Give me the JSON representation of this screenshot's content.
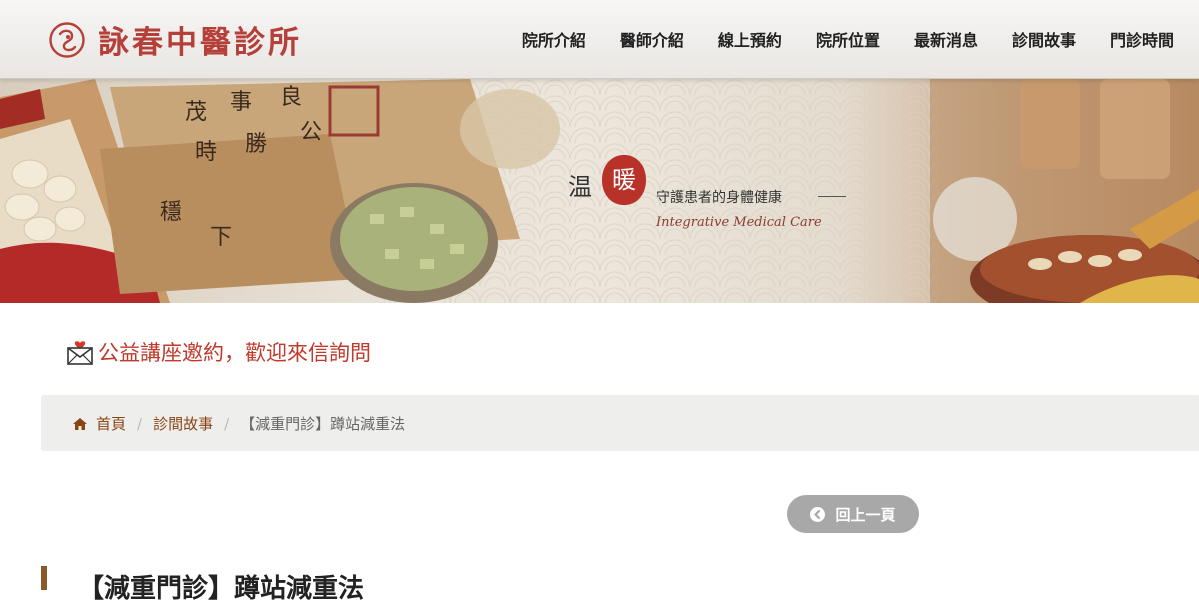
{
  "header": {
    "logo_text": "詠春中醫診所",
    "nav": [
      {
        "label": "院所介紹"
      },
      {
        "label": "醫師介紹"
      },
      {
        "label": "線上預約"
      },
      {
        "label": "院所位置"
      },
      {
        "label": "最新消息"
      },
      {
        "label": "診間故事"
      },
      {
        "label": "門診時間"
      }
    ]
  },
  "banner": {
    "calligraphy": "温",
    "seal": "暖",
    "subtitle": "守護患者的身體健康",
    "english": "Integrative Medical Care"
  },
  "notice": {
    "text": "公益講座邀約，歡迎來信詢問",
    "icon": "envelope-heart-icon"
  },
  "breadcrumb": {
    "home": "首頁",
    "section": "診間故事",
    "current": "【減重門診】蹲站減重法",
    "separator": "/"
  },
  "back_button": {
    "label": "回上一頁"
  },
  "article": {
    "title": "【減重門診】蹲站減重法"
  },
  "colors": {
    "brand": "#b5403a",
    "accent_brown": "#8b4513",
    "notice_red": "#c0392b",
    "button_grey": "#a8a8a8"
  }
}
